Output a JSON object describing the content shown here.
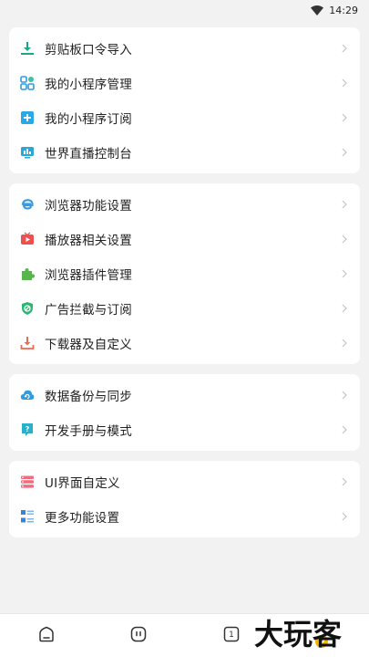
{
  "status": {
    "time": "14:29"
  },
  "sections": [
    {
      "items": [
        {
          "label": "剪贴板口令导入",
          "icon": "clipboard-import-icon",
          "color": "#1aa785"
        },
        {
          "label": "我的小程序管理",
          "icon": "mini-program-grid-icon",
          "color": "#2e9ce0"
        },
        {
          "label": "我的小程序订阅",
          "icon": "subscribe-add-icon",
          "color": "#26a9e8"
        },
        {
          "label": "世界直播控制台",
          "icon": "live-console-icon",
          "color": "#2aa6d8"
        }
      ]
    },
    {
      "items": [
        {
          "label": "浏览器功能设置",
          "icon": "browser-e-icon",
          "color": "#3b9be0"
        },
        {
          "label": "播放器相关设置",
          "icon": "player-icon",
          "color": "#ef4f4f"
        },
        {
          "label": "浏览器插件管理",
          "icon": "puzzle-plugin-icon",
          "color": "#58b44c"
        },
        {
          "label": "广告拦截与订阅",
          "icon": "shield-block-icon",
          "color": "#2bb673"
        },
        {
          "label": "下载器及自定义",
          "icon": "download-icon",
          "color": "#f0684f"
        }
      ]
    },
    {
      "items": [
        {
          "label": "数据备份与同步",
          "icon": "cloud-sync-icon",
          "color": "#2e9ce0"
        },
        {
          "label": "开发手册与模式",
          "icon": "help-doc-icon",
          "color": "#2ab1c9"
        }
      ]
    },
    {
      "items": [
        {
          "label": "UI界面自定义",
          "icon": "ui-layout-icon",
          "color": "#f16c7f"
        },
        {
          "label": "更多功能设置",
          "icon": "more-settings-icon",
          "color": "#2e86de"
        }
      ]
    }
  ],
  "bottom_nav": {
    "tab_count": "1"
  },
  "watermark": {
    "text": "大玩客"
  }
}
